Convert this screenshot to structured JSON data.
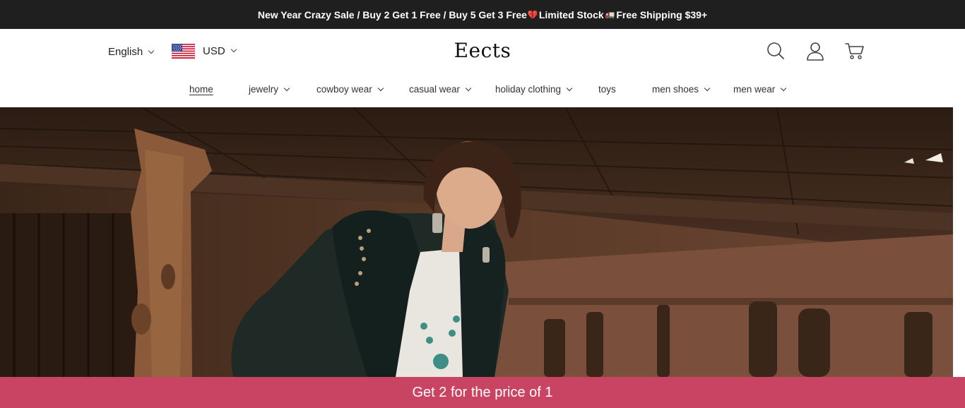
{
  "announcement": {
    "part1": "New Year Crazy Sale / Buy 2 Get 1 Free / Buy 5 Get 3 Free",
    "heart_icon": "💔",
    "part2": "Limited Stock",
    "truck_icon": "🚛",
    "part3": "Free Shipping $39+"
  },
  "header": {
    "language": "English",
    "currency": "USD",
    "logo": "Eects",
    "icons": [
      "search-icon",
      "account-icon",
      "cart-icon"
    ]
  },
  "nav": {
    "items": [
      {
        "label": "home",
        "has_dropdown": false,
        "active": true
      },
      {
        "label": "jewelry",
        "has_dropdown": true
      },
      {
        "label": "cowboy wear",
        "has_dropdown": true
      },
      {
        "label": "casual wear",
        "has_dropdown": true
      },
      {
        "label": "holiday clothing",
        "has_dropdown": true
      },
      {
        "label": "toys",
        "has_dropdown": false
      },
      {
        "label": "men shoes",
        "has_dropdown": true
      },
      {
        "label": "men wear",
        "has_dropdown": true
      }
    ]
  },
  "promo": {
    "text": "Get 2 for the price of 1",
    "background": "#c94463"
  },
  "colors": {
    "announce_bg": "#1f1f1f",
    "promo_bg": "#c94463"
  }
}
